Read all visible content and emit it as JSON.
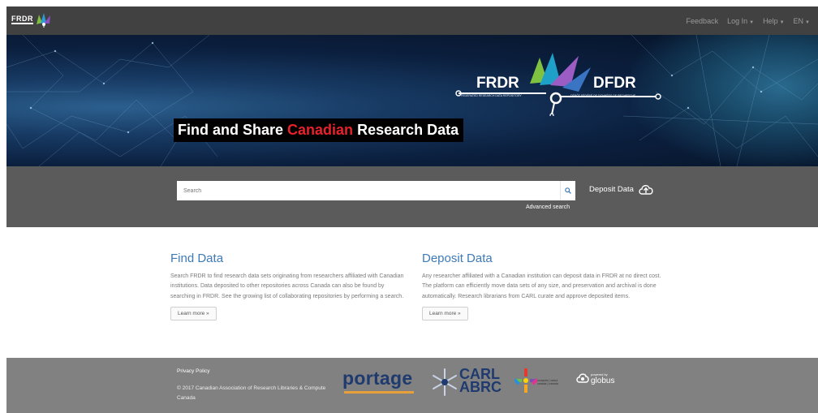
{
  "nav": {
    "brand_text": "FRDR",
    "links": [
      {
        "label": "Feedback",
        "caret": false
      },
      {
        "label": "Log In",
        "caret": true
      },
      {
        "label": "Help",
        "caret": true
      },
      {
        "label": "EN",
        "caret": true
      }
    ]
  },
  "hero": {
    "title_before": "Find and Share ",
    "title_accent": "Canadian",
    "title_after": " Research Data",
    "logo_left": "FRDR",
    "logo_right": "DFDR",
    "logo_sub_left": "FEDERATED RESEARCH DATA REPOSITORY",
    "logo_sub_right": "DÉPÔT FÉDÉRÉ DE DONNÉES DE RECHERCHE"
  },
  "search": {
    "placeholder": "Search",
    "advanced_label": "Advanced search",
    "deposit_label": "Deposit Data"
  },
  "find": {
    "heading": "Find Data",
    "body": "Search FRDR to find research data sets originating from researchers affiliated with Canadian institutions. Data deposited to other repositories across Canada can also be found by searching in FRDR. See the growing list of collaborating repositories by performing a search.",
    "button": "Learn more »"
  },
  "deposit": {
    "heading": "Deposit Data",
    "body": "Any researcher affiliated with a Canadian institution can deposit data in FRDR at no direct cost. The platform can efficiently move data sets of any size, and preservation and archival is done automatically. Research librarians from CARL curate and approve deposited items.",
    "button": "Learn more »"
  },
  "footer": {
    "privacy": "Privacy Policy",
    "copyright": "© 2017 Canadian Association of Research Libraries & Compute Canada",
    "portage": "portage",
    "carl_line1": "CARL",
    "carl_line2": "ABRC",
    "compute_canada_line1": "compute | calcul",
    "compute_canada_line2": "canada | canada",
    "globus_small": "powered by",
    "globus": "globus"
  },
  "colors": {
    "topbar": "#414141",
    "search_band": "#5b5b5b",
    "footer": "#818181",
    "heading_blue": "#3d7ab8",
    "accent_red": "#e8212b"
  }
}
